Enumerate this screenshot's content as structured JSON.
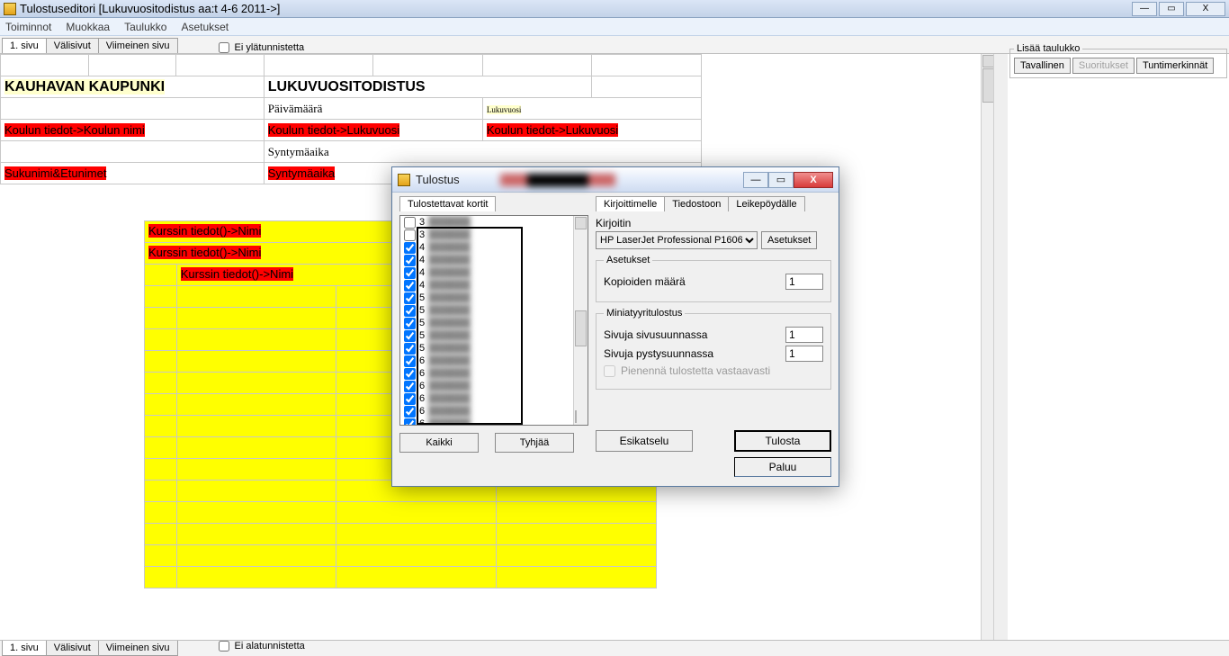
{
  "window": {
    "title": "Tulostuseditori [Lukuvuositodistus  aa:t 4-6  2011->]",
    "min": "—",
    "max": "▭",
    "close": "X"
  },
  "menu": {
    "items": [
      "Toiminnot",
      "Muokkaa",
      "Taulukko",
      "Asetukset"
    ]
  },
  "tabs": {
    "items": [
      "1. sivu",
      "Välisivut",
      "Viimeinen sivu"
    ],
    "no_header": "Ei ylätunnistetta",
    "no_footer": "Ei alatunnistetta"
  },
  "doc": {
    "org": "KAUHAVAN KAUPUNKI",
    "h1": "LUKUVUOSITODISTUS",
    "lbl_date": "Päivämäärä",
    "lbl_year": "Lukuvuosi",
    "fld_school": "Koulun tiedot->Koulun nimi",
    "fld_year_a": "Koulun tiedot->Lukuvuosi",
    "fld_year_b": "Koulun tiedot->Lukuvuosi",
    "lbl_birth": "Syntymäaika",
    "fld_name": "Sukunimi&Etunimet",
    "fld_birth": "Syntymäaika",
    "fld_course": "Kurssin tiedot()->Nimi"
  },
  "side": {
    "legend": "Lisää taulukko",
    "btn_basic": "Tavallinen",
    "btn_perf": "Suoritukset",
    "btn_hours": "Tuntimerkinnät"
  },
  "dialog": {
    "title": "Tulostus",
    "tab_cards": "Tulostettavat kortit",
    "btn_all": "Kaikki",
    "btn_clear": "Tyhjää",
    "tabs_dest": [
      "Kirjoittimelle",
      "Tiedostoon",
      "Leikepöydälle"
    ],
    "lbl_printer": "Kirjoitin",
    "printer": "HP LaserJet Professional P1606dn",
    "btn_settings": "Asetukset",
    "grp_settings": "Asetukset",
    "lbl_copies": "Kopioiden määrä",
    "val_copies": "1",
    "grp_mini": "Miniatyyritulostus",
    "lbl_across": "Sivuja sivusuunnassa",
    "val_across": "1",
    "lbl_down": "Sivuja pystysuunnassa",
    "val_down": "1",
    "chk_shrink": "Pienennä tulostetta vastaavasti",
    "btn_preview": "Esikatselu",
    "btn_print": "Tulosta",
    "btn_return": "Paluu",
    "list": [
      {
        "n": "3",
        "c": false
      },
      {
        "n": "3",
        "c": false
      },
      {
        "n": "4",
        "c": true
      },
      {
        "n": "4",
        "c": true
      },
      {
        "n": "4",
        "c": true
      },
      {
        "n": "4",
        "c": true
      },
      {
        "n": "5",
        "c": true
      },
      {
        "n": "5",
        "c": true
      },
      {
        "n": "5",
        "c": true
      },
      {
        "n": "5",
        "c": true
      },
      {
        "n": "5",
        "c": true
      },
      {
        "n": "6",
        "c": true
      },
      {
        "n": "6",
        "c": true
      },
      {
        "n": "6",
        "c": true
      },
      {
        "n": "6",
        "c": true
      },
      {
        "n": "6",
        "c": true
      },
      {
        "n": "6",
        "c": true
      }
    ]
  }
}
